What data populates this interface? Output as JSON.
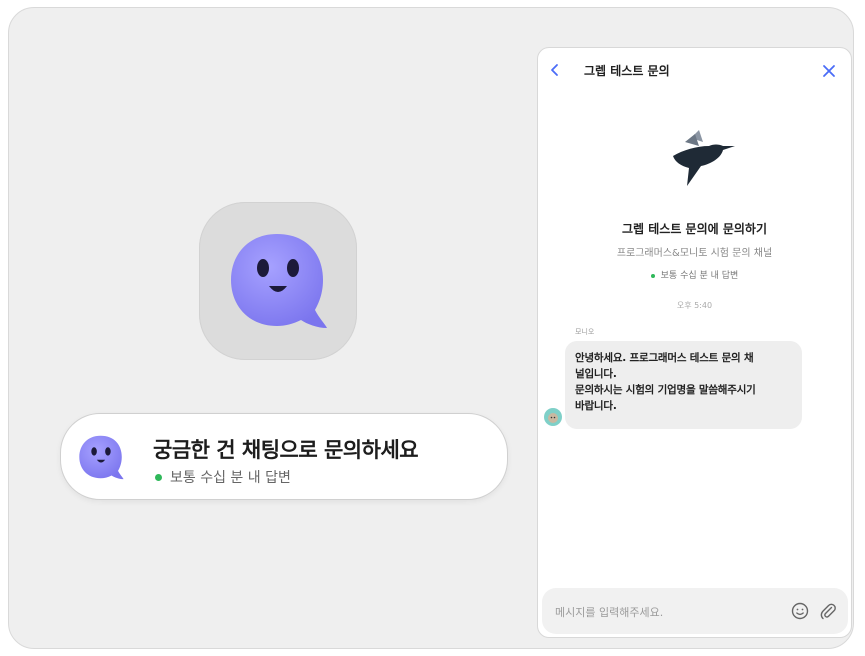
{
  "banner": {
    "title": "궁금한 건 채팅으로 문의하세요",
    "status": "보통 수십 분 내 답변"
  },
  "chat": {
    "title": "그렙 테스트 문의",
    "welcome_title": "그렙 테스트 문의에 문의하기",
    "welcome_subtitle": "프로그래머스&모니토 시험 문의 채널",
    "welcome_status": "보통 수십 분 내 답변",
    "time": "오후 5:40",
    "sender": "모니오",
    "message_lines": [
      "안녕하세요. 프로그래머스 테스트 문의 채",
      "널입니다.",
      "문의하시는 시험의 기업명을 말씀해주시기",
      "바랍니다."
    ],
    "input_placeholder": "메시지를 입력해주세요."
  },
  "colors": {
    "accent": "#4a6cf7",
    "mascot": "#8b86f2",
    "status_green": "#2fb85a",
    "logo": "#1f2a36"
  },
  "icons": [
    "back-icon",
    "close-icon",
    "emoji-icon",
    "paperclip-icon",
    "hummingbird-logo",
    "mascot-icon"
  ]
}
